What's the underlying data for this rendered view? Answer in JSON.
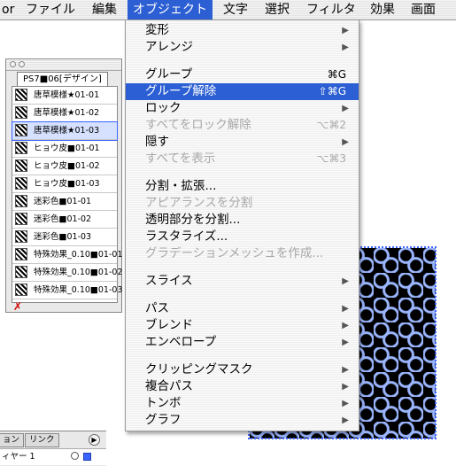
{
  "menubar": {
    "items": [
      {
        "label": "or"
      },
      {
        "label": "ファイル"
      },
      {
        "label": "編集"
      },
      {
        "label": "オブジェクト"
      },
      {
        "label": "文字"
      },
      {
        "label": "選択"
      },
      {
        "label": "フィルタ"
      },
      {
        "label": "効果"
      },
      {
        "label": "画面"
      }
    ],
    "active_index": 3
  },
  "swatch_palette": {
    "tab_label": "PS7■06[デザイン]",
    "rows": [
      {
        "label": "唐草模様★01-01",
        "selected": false
      },
      {
        "label": "唐草模様★01-02",
        "selected": false
      },
      {
        "label": "唐草模様★01-03",
        "selected": true
      },
      {
        "label": "ヒョウ皮■01-01",
        "selected": false
      },
      {
        "label": "ヒョウ皮■01-02",
        "selected": false
      },
      {
        "label": "ヒョウ皮■01-03",
        "selected": false
      },
      {
        "label": "迷彩色■01-01",
        "selected": false
      },
      {
        "label": "迷彩色■01-02",
        "selected": false
      },
      {
        "label": "迷彩色■01-03",
        "selected": false
      },
      {
        "label": "特殊効果_0.10■01-01",
        "selected": false
      },
      {
        "label": "特殊効果_0.10■01-02",
        "selected": false
      },
      {
        "label": "特殊効果_0.10■01-03",
        "selected": false
      }
    ],
    "none_swatch_icon": "none-swatch-icon"
  },
  "layer_palette": {
    "tab1": "ョン",
    "tab2": "リンク",
    "layer_name": "ィヤー 1"
  },
  "object_menu": {
    "items": [
      {
        "label": "変形",
        "submenu": true,
        "enabled": true
      },
      {
        "label": "アレンジ",
        "submenu": true,
        "enabled": true
      },
      {
        "separator": true
      },
      {
        "label": "グループ",
        "shortcut": "⌘G",
        "enabled": true
      },
      {
        "label": "グループ解除",
        "shortcut": "⇧⌘G",
        "enabled": true,
        "highlighted": true
      },
      {
        "label": "ロック",
        "submenu": true,
        "enabled": true
      },
      {
        "label": "すべてをロック解除",
        "shortcut": "⌥⌘2",
        "enabled": false
      },
      {
        "label": "隠す",
        "submenu": true,
        "enabled": true
      },
      {
        "label": "すべてを表示",
        "shortcut": "⌥⌘3",
        "enabled": false
      },
      {
        "separator": true
      },
      {
        "label": "分割・拡張...",
        "enabled": true
      },
      {
        "label": "アピアランスを分割",
        "enabled": false
      },
      {
        "label": "透明部分を分割...",
        "enabled": true
      },
      {
        "label": "ラスタライズ...",
        "enabled": true
      },
      {
        "label": "グラデーションメッシュを作成...",
        "enabled": false
      },
      {
        "separator": true
      },
      {
        "label": "スライス",
        "submenu": true,
        "enabled": true
      },
      {
        "separator": true
      },
      {
        "label": "パス",
        "submenu": true,
        "enabled": true
      },
      {
        "label": "ブレンド",
        "submenu": true,
        "enabled": true
      },
      {
        "label": "エンベロープ",
        "submenu": true,
        "enabled": true
      },
      {
        "separator": true
      },
      {
        "label": "クリッピングマスク",
        "submenu": true,
        "enabled": true
      },
      {
        "label": "複合パス",
        "submenu": true,
        "enabled": true
      },
      {
        "label": "トンボ",
        "submenu": true,
        "enabled": true
      },
      {
        "label": "グラフ",
        "submenu": true,
        "enabled": true
      }
    ]
  },
  "colors": {
    "highlight": "#2c5fd3",
    "selection_outline": "#3a64ff",
    "disabled_text": "#a8a8a8"
  }
}
